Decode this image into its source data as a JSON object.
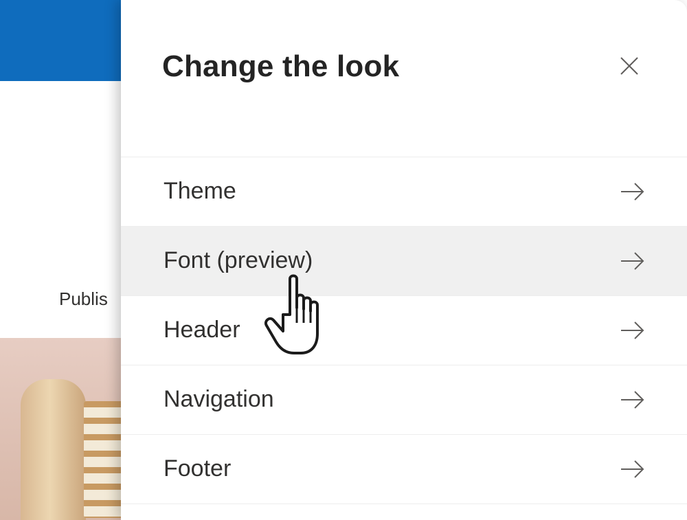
{
  "background": {
    "header_color": "#0f6cbd",
    "publish_text": "Publis"
  },
  "panel": {
    "title": "Change the look",
    "close_icon": "close-icon",
    "items": [
      {
        "label": "Theme",
        "icon": "arrow-right-icon"
      },
      {
        "label": "Font (preview)",
        "icon": "arrow-right-icon",
        "state": "hover"
      },
      {
        "label": "Header",
        "icon": "arrow-right-icon"
      },
      {
        "label": "Navigation",
        "icon": "arrow-right-icon"
      },
      {
        "label": "Footer",
        "icon": "arrow-right-icon"
      }
    ]
  },
  "cursor": {
    "icon": "hand-pointer-icon"
  }
}
